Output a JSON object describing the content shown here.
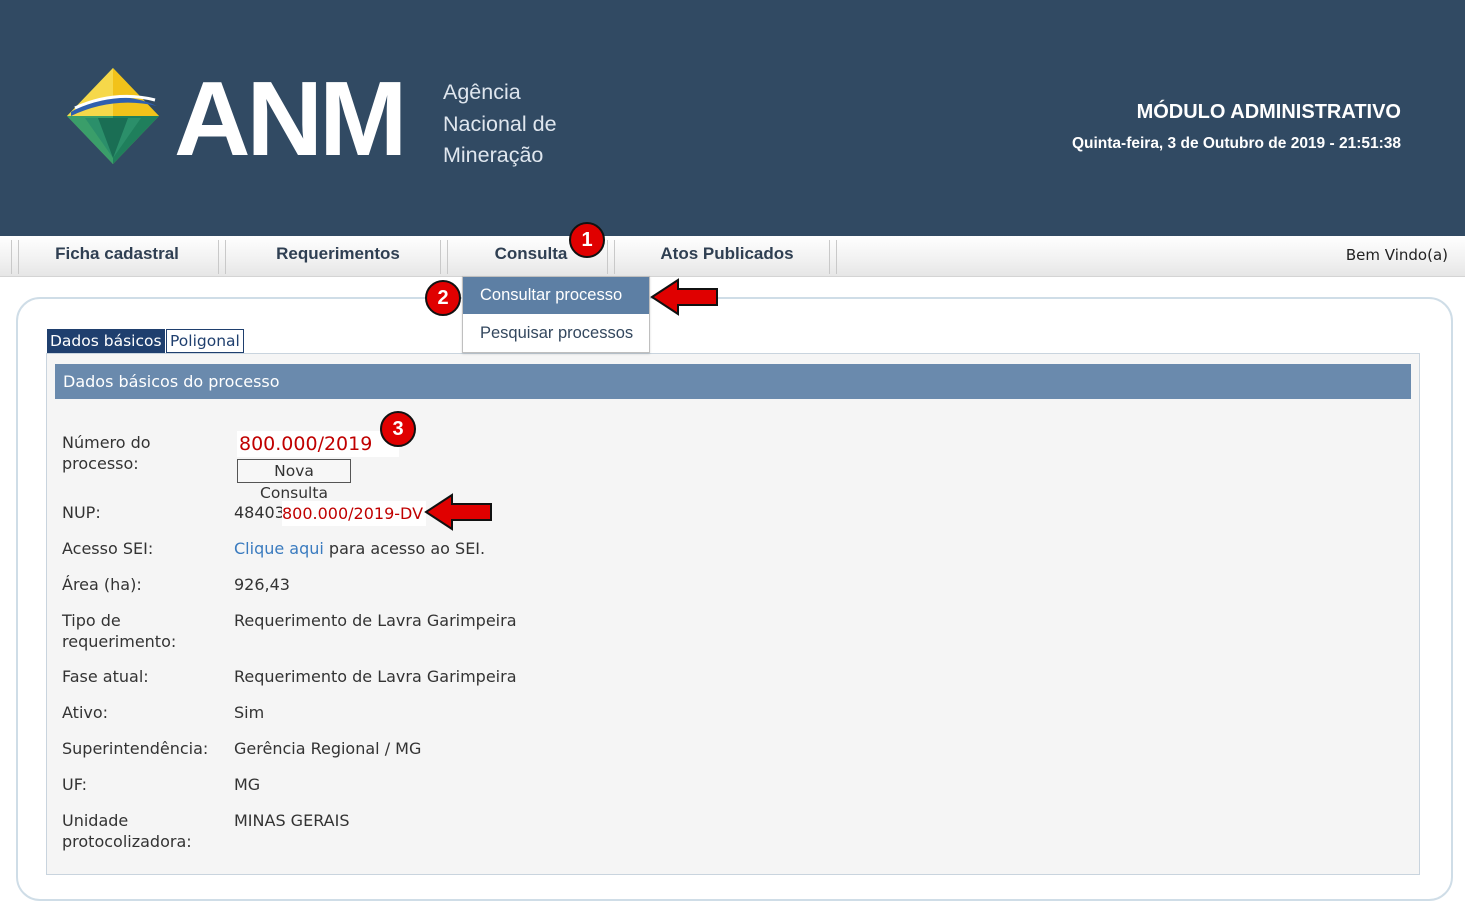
{
  "header": {
    "logo_text": "ANM",
    "agency_lines": [
      "Agência",
      "Nacional de",
      "Mineração"
    ],
    "module_title": "MÓDULO ADMINISTRATIVO",
    "datetime": "Quinta-feira, 3 de Outubro de 2019 - 21:51:38"
  },
  "menu": {
    "items": [
      {
        "label": "Ficha cadastral"
      },
      {
        "label": "Requerimentos"
      },
      {
        "label": "Consulta"
      },
      {
        "label": "Atos Publicados"
      }
    ],
    "welcome": "Bem Vindo(a)",
    "dropdown": [
      {
        "label": "Consultar processo"
      },
      {
        "label": "Pesquisar processos"
      }
    ]
  },
  "tabs": [
    {
      "label": "Dados básicos"
    },
    {
      "label": "Poligonal"
    }
  ],
  "section_title": "Dados básicos do processo",
  "process": {
    "number_label": "Número do processo:",
    "number_value": "800.000/2019",
    "new_query_button": "Nova Consulta"
  },
  "fields": {
    "nup": {
      "label": "NUP:",
      "prefix": "48403.",
      "highlight": "800.000/2019-DV"
    },
    "acesso_sei": {
      "label": "Acesso SEI:",
      "link": "Clique aqui",
      "rest": " para acesso ao SEI."
    },
    "area": {
      "label": "Área (ha):",
      "value": "926,43"
    },
    "tipo": {
      "label_line1": "Tipo de",
      "label_line2": "requerimento:",
      "value": "Requerimento de Lavra Garimpeira"
    },
    "fase": {
      "label": "Fase atual:",
      "value": "Requerimento de Lavra Garimpeira"
    },
    "ativo": {
      "label": "Ativo:",
      "value": "Sim"
    },
    "superintendencia": {
      "label": "Superintendência:",
      "value": "Gerência Regional / MG"
    },
    "uf": {
      "label": "UF:",
      "value": "MG"
    },
    "unidade": {
      "label_line1": "Unidade",
      "label_line2": "protocolizadora:",
      "value": "MINAS GERAIS"
    }
  },
  "annotations": {
    "badge1": "1",
    "badge2": "2",
    "badge3": "3"
  },
  "colors": {
    "header_bg": "#314a63",
    "section_bg": "#6a8aad",
    "dropdown_active": "#5d7fa4",
    "highlight_text": "#c00000",
    "badge_red": "#e00000"
  }
}
